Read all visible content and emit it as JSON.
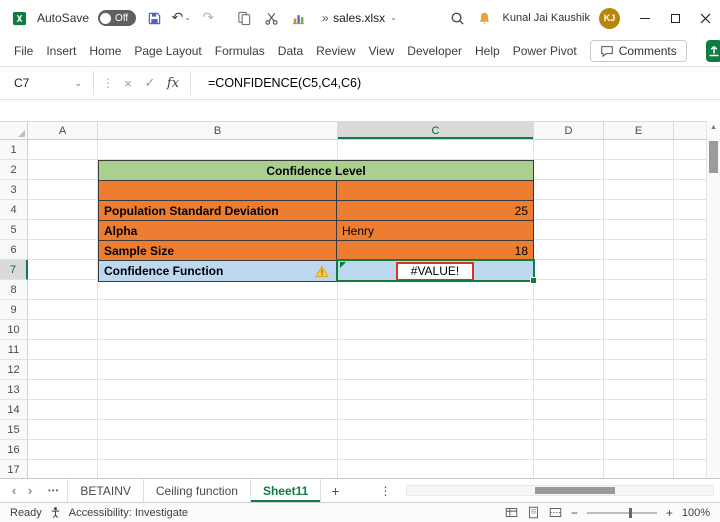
{
  "colors": {
    "excel_green": "#107C41",
    "table_header_green": "#A9D08E",
    "table_orange": "#ED7D31",
    "table_blue": "#BDD7EE",
    "annotation_red": "#E0301E",
    "avatar_gold": "#B8860B"
  },
  "icons": {
    "undo": "↶",
    "redo": "↷",
    "dropdown": "⌄",
    "overflow": "»",
    "cancel": "×",
    "enter": "✓",
    "more_dots": "⋮",
    "sheet_dots": "•••",
    "nav_left": "‹",
    "nav_right": "›",
    "add_sheet": "+",
    "scroll_up": "▲",
    "minus": "−",
    "plus": "+"
  },
  "titlebar": {
    "autosave_label": "AutoSave",
    "autosave_state": "Off",
    "filename": "sales.xlsx",
    "user_name": "Kunal Jai Kaushik",
    "user_initials": "KJ"
  },
  "menubar": {
    "tabs": [
      "File",
      "Insert",
      "Home",
      "Page Layout",
      "Formulas",
      "Data",
      "Review",
      "View",
      "Developer",
      "Help",
      "Power Pivot"
    ],
    "comments_label": "Comments"
  },
  "formula_bar": {
    "name_box": "C7",
    "insert_function_label": "fx",
    "formula": "=CONFIDENCE(C5,C4,C6)"
  },
  "grid": {
    "columns": [
      "A",
      "B",
      "C",
      "D",
      "E"
    ],
    "row_numbers": [
      "1",
      "2",
      "3",
      "4",
      "5",
      "6",
      "7",
      "8",
      "9",
      "10",
      "11",
      "12",
      "13",
      "14",
      "15",
      "16",
      "17"
    ],
    "selected_cell": "C7"
  },
  "table": {
    "title": "Confidence Level",
    "rows": [
      {
        "label": "Population Standard Deviation",
        "value": "25"
      },
      {
        "label": "Alpha",
        "value": "Henry"
      },
      {
        "label": "Sample Size",
        "value": "18"
      },
      {
        "label": "Confidence Function",
        "value": "#VALUE!"
      }
    ]
  },
  "sheet_tabs": {
    "tabs": [
      "BETAINV",
      "Ceiling function",
      "Sheet11"
    ],
    "active_tab": "Sheet11"
  },
  "status_bar": {
    "mode": "Ready",
    "accessibility": "Accessibility: Investigate",
    "zoom": "100%"
  }
}
